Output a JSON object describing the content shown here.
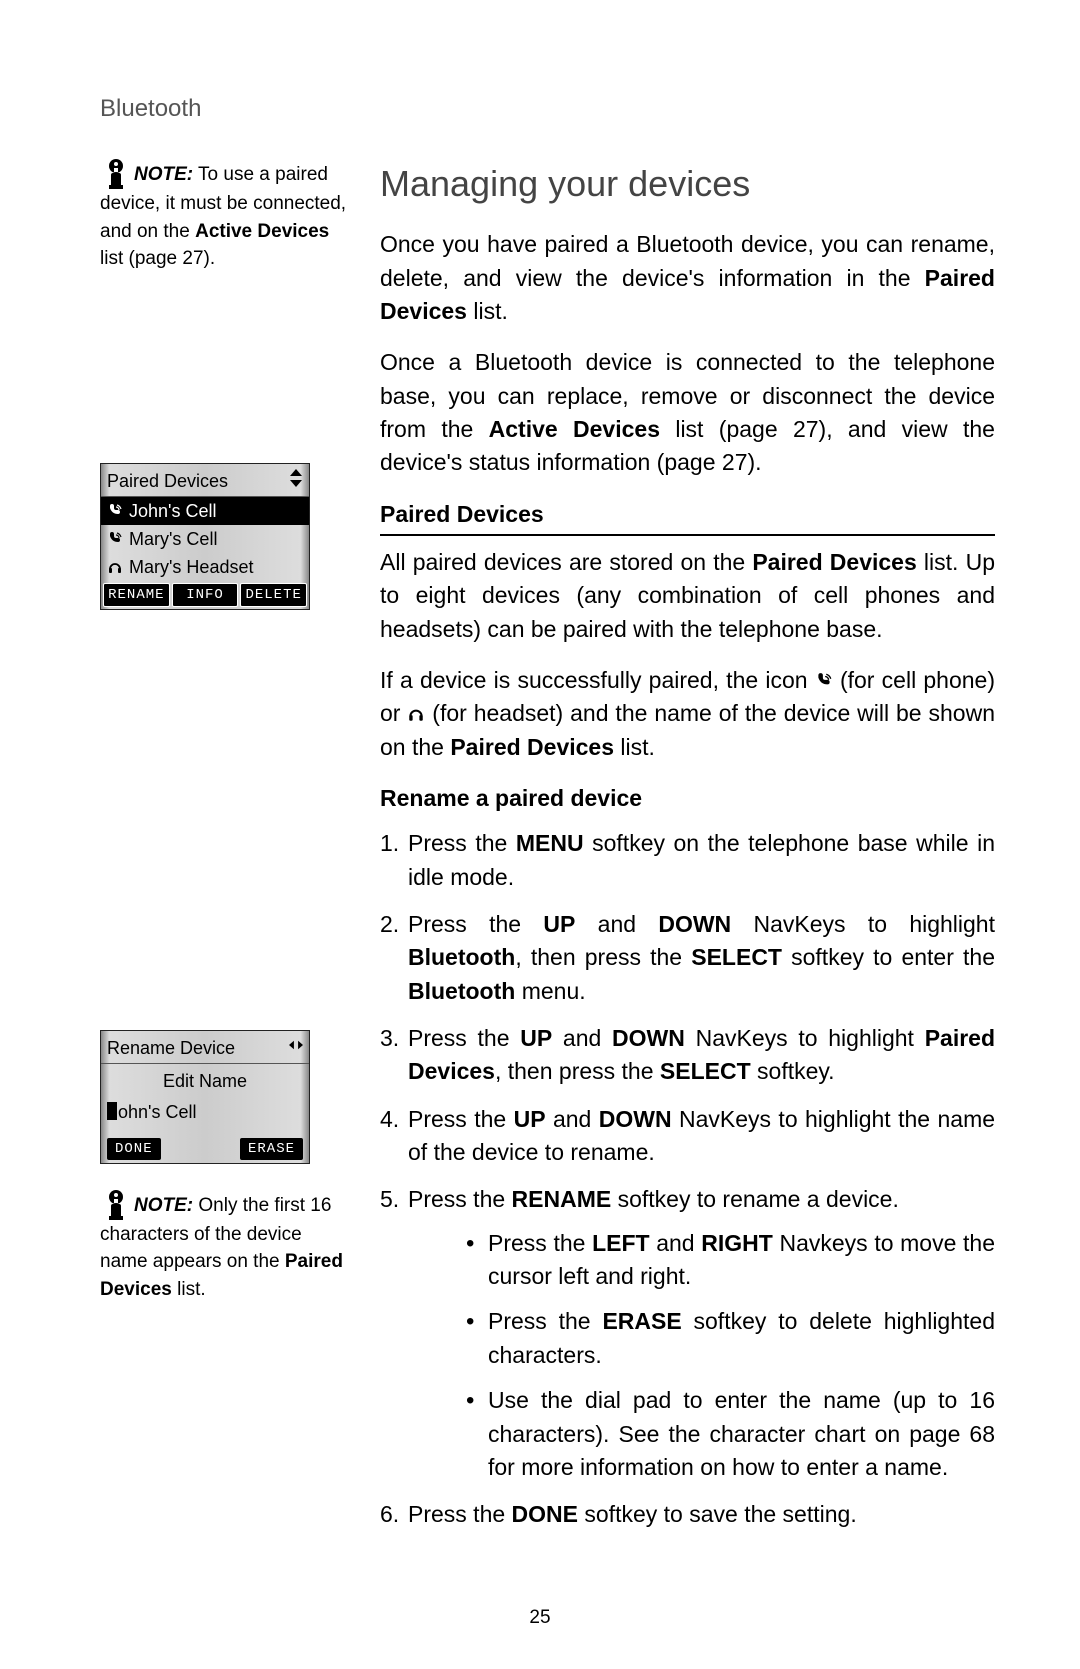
{
  "header": {
    "section": "Bluetooth"
  },
  "sidebar": {
    "note1": {
      "label": "NOTE:",
      "text_a": " To use a paired device, it must be connected, and on the ",
      "bold_a": "Active Devices",
      "text_b": " list (page 27)."
    },
    "lcd1": {
      "title": "Paired Devices",
      "rows": [
        {
          "icon": "phone-signal-icon",
          "label": "John's Cell",
          "selected": true
        },
        {
          "icon": "phone-signal-icon",
          "label": "Mary's Cell",
          "selected": false
        },
        {
          "icon": "headset-icon",
          "label": "Mary's Headset",
          "selected": false
        }
      ],
      "softkeys": [
        "RENAME",
        "INFO",
        "DELETE"
      ]
    },
    "lcd2": {
      "title": "Rename Device",
      "subtitle": "Edit Name",
      "value": "ohn's Cell",
      "softkeys": [
        "DONE",
        "ERASE"
      ]
    },
    "note2": {
      "label": "NOTE:",
      "text_a": " Only the first 16 characters of the device name appears on the ",
      "bold_a": "Paired Devices",
      "text_b": " list."
    }
  },
  "main": {
    "title": "Managing your devices",
    "p1_a": "Once you have paired a Bluetooth device, you can rename, delete, and view the device's information in the ",
    "p1_b": "Paired Devices",
    "p1_c": " list.",
    "p2_a": "Once a Bluetooth device is connected to the telephone base, you can replace, remove or disconnect the device from the ",
    "p2_b": "Active Devices",
    "p2_c": " list (page 27), and view the device's status information (page 27).",
    "h2": "Paired Devices",
    "p3_a": "All paired devices are stored on the ",
    "p3_b": "Paired Devices",
    "p3_c": " list. Up to eight devices (any combination of cell phones and headsets) can be paired with the telephone base.",
    "p4_a": "If a device is successfully paired, the icon ",
    "p4_b": " (for cell phone) or ",
    "p4_c": " (for headset) and the name of the device will be shown on the ",
    "p4_d": "Paired Devices",
    "p4_e": " list.",
    "h3": "Rename a paired device",
    "steps": {
      "s1_a": "Press the ",
      "s1_b": "MENU",
      "s1_c": " softkey on the telephone base while in idle mode.",
      "s2_a": "Press the ",
      "s2_b": "UP",
      "s2_c": " and ",
      "s2_d": "DOWN",
      "s2_e": " NavKeys to highlight ",
      "s2_f": "Bluetooth",
      "s2_g": ", then press the ",
      "s2_h": "SELECT",
      "s2_i": " softkey to enter the ",
      "s2_j": "Bluetooth",
      "s2_k": " menu.",
      "s3_a": "Press the ",
      "s3_b": "UP",
      "s3_c": " and ",
      "s3_d": "DOWN",
      "s3_e": " NavKeys to highlight ",
      "s3_f": "Paired Devices",
      "s3_g": ", then press the ",
      "s3_h": "SELECT",
      "s3_i": " softkey.",
      "s4_a": "Press the ",
      "s4_b": "UP",
      "s4_c": " and ",
      "s4_d": "DOWN",
      "s4_e": " NavKeys to highlight the name of the device to rename.",
      "s5_a": "Press the ",
      "s5_b": "RENAME",
      "s5_c": " softkey to rename a device.",
      "b1_a": "Press the ",
      "b1_b": "LEFT",
      "b1_c": " and ",
      "b1_d": "RIGHT",
      "b1_e": " Navkeys to move the cursor left and right.",
      "b2_a": "Press the ",
      "b2_b": "ERASE",
      "b2_c": " softkey to delete highlighted characters.",
      "b3": "Use the dial pad to enter the name (up to 16 characters). See the character chart on page 68 for more information on how to enter a name.",
      "s6_a": "Press the ",
      "s6_b": "DONE",
      "s6_c": " softkey to save the setting."
    }
  },
  "page_number": "25"
}
